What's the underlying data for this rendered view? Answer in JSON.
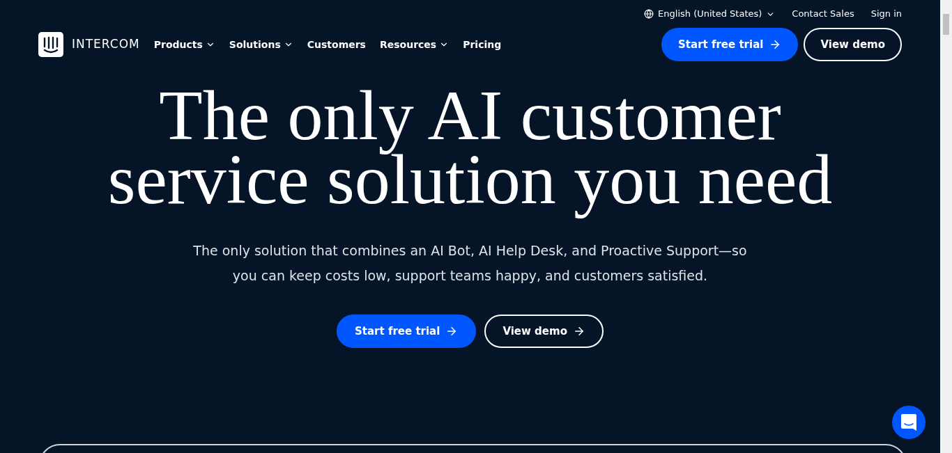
{
  "utility_bar": {
    "language": "English (United States)",
    "links": [
      "Contact Sales",
      "Sign in"
    ]
  },
  "nav": {
    "brand": "INTERCOM",
    "items": [
      {
        "label": "Products",
        "has_menu": true
      },
      {
        "label": "Solutions",
        "has_menu": true
      },
      {
        "label": "Customers",
        "has_menu": false
      },
      {
        "label": "Resources",
        "has_menu": true
      },
      {
        "label": "Pricing",
        "has_menu": false
      }
    ],
    "buttons": [
      {
        "label": "Start free trial",
        "kind": "primary",
        "arrow": true
      },
      {
        "label": "View demo",
        "kind": "outline",
        "arrow": false
      }
    ]
  },
  "hero": {
    "title_lines": [
      "The only AI customer",
      "service solution you need"
    ],
    "subtitle": "The only solution that combines an AI Bot, AI Help Desk, and Proactive Support—so you can keep costs low, support teams happy, and customers satisfied.",
    "buttons": [
      {
        "label": "Start free trial",
        "kind": "primary",
        "arrow": true
      },
      {
        "label": "View demo",
        "kind": "outline",
        "arrow": true
      }
    ]
  }
}
